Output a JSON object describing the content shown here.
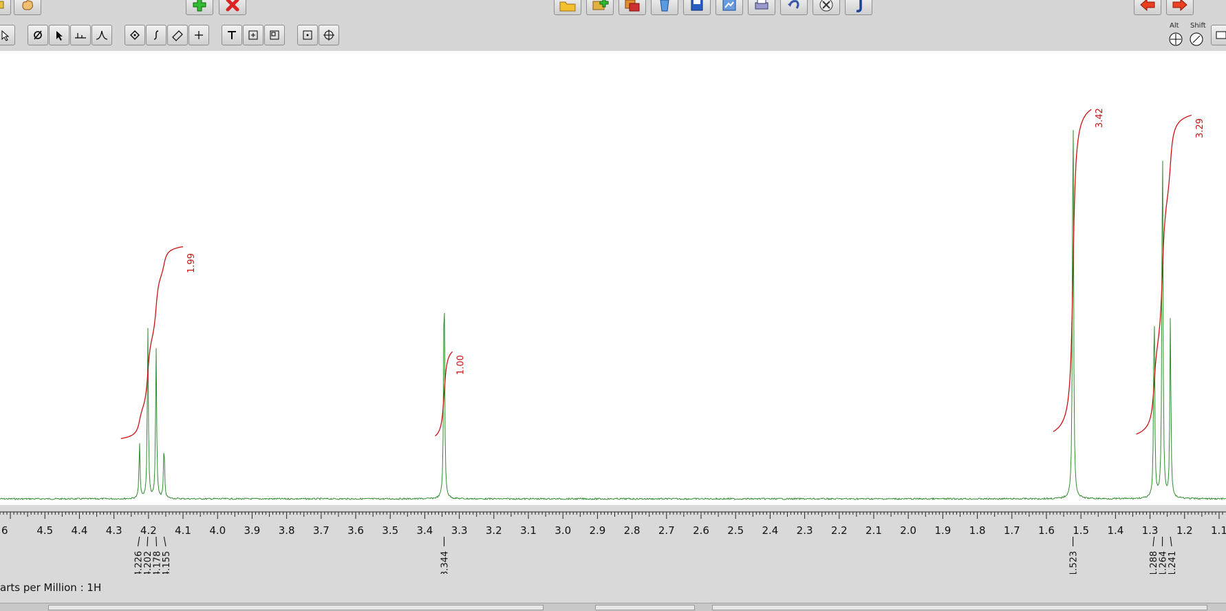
{
  "toolbar": {
    "top_buttons": [
      {
        "name": "partial-button-icon",
        "color": "#b8860b"
      },
      {
        "name": "hand-icon",
        "color": "#b8860b"
      },
      {
        "name": "add-icon",
        "color": "#22aa22"
      },
      {
        "name": "delete-icon",
        "color": "#dd2222"
      },
      {
        "name": "open-folder-icon",
        "color": "#e8b020"
      },
      {
        "name": "add-data-icon",
        "color": "#d4a020"
      },
      {
        "name": "copy-data-icon",
        "color": "#cc6600"
      },
      {
        "name": "trash-icon",
        "color": "#3a7fd0"
      },
      {
        "name": "save-icon",
        "color": "#1a4fb0"
      },
      {
        "name": "export-icon",
        "color": "#4a7fd0"
      },
      {
        "name": "print-icon",
        "color": "#5a5a9a"
      },
      {
        "name": "undo-icon",
        "color": "#3355aa"
      },
      {
        "name": "close-doc-icon",
        "color": "#444444"
      },
      {
        "name": "coupling-j-icon",
        "color": "#1a3fa0"
      },
      {
        "name": "back-arrow-icon",
        "color": "#e03020"
      },
      {
        "name": "forward-arrow-icon",
        "color": "#e03020"
      }
    ],
    "second_row": [
      "pointer-icon",
      "phase-icon",
      "select-arrow-icon",
      "baseline-icon",
      "peak-pick-icon",
      "region-icon",
      "integral-icon",
      "ruler-icon",
      "crosshair-icon",
      "text-icon",
      "annotation-box-icon",
      "frame-icon",
      "zoom-box-icon",
      "move-icon"
    ],
    "modifier_alt": "Alt",
    "modifier_shift": "Shift"
  },
  "status": {
    "axis_label": "arts per Million : 1H"
  },
  "chart_data": {
    "type": "line",
    "x_axis": {
      "direction": "descending",
      "range": [
        4.63,
        1.08
      ],
      "tick_labels": [
        "6",
        "4.5",
        "4.4",
        "4.3",
        "4.2",
        "4.1",
        "4.0",
        "3.9",
        "3.8",
        "3.7",
        "3.6",
        "3.5",
        "3.4",
        "3.3",
        "3.2",
        "3.1",
        "3.0",
        "2.9",
        "2.8",
        "2.7",
        "2.6",
        "2.5",
        "2.4",
        "2.3",
        "2.2",
        "2.1",
        "2.0",
        "1.9",
        "1.8",
        "1.7",
        "1.6",
        "1.5",
        "1.4",
        "1.3",
        "1.2",
        "1.1"
      ]
    },
    "peaks": [
      {
        "ppm": 4.226,
        "label": "4.226",
        "height": 0.32
      },
      {
        "ppm": 4.202,
        "label": "4.202",
        "height": 0.99
      },
      {
        "ppm": 4.178,
        "label": "4.178",
        "height": 0.86
      },
      {
        "ppm": 4.155,
        "label": "4.155",
        "height": 0.31
      },
      {
        "ppm": 3.344,
        "label": "3.344",
        "height": 1.33
      },
      {
        "ppm": 1.523,
        "label": "1.523",
        "height": 2.45
      },
      {
        "ppm": 1.288,
        "label": "1.288",
        "height": 1.16
      },
      {
        "ppm": 1.264,
        "label": "1.264",
        "height": 2.21
      },
      {
        "ppm": 1.241,
        "label": "1.241",
        "height": 1.05
      }
    ],
    "integrals": [
      {
        "from": 4.28,
        "to": 4.1,
        "value": "1.99"
      },
      {
        "from": 3.37,
        "to": 3.32,
        "value": "1.00"
      },
      {
        "from": 1.58,
        "to": 1.47,
        "value": "3.42"
      },
      {
        "from": 1.34,
        "to": 1.18,
        "value": "3.29"
      }
    ],
    "colors": {
      "spectrum": "#2e8b2e",
      "integral": "#cc1111",
      "axis": "#222222"
    }
  }
}
